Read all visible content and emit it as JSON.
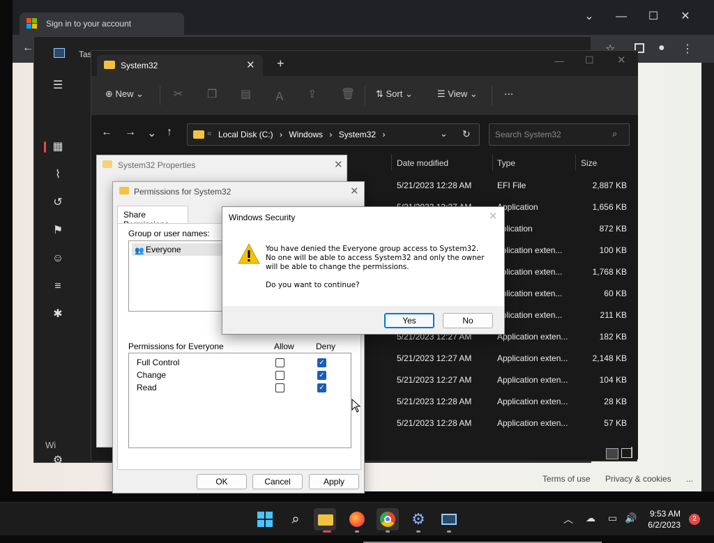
{
  "browser": {
    "tab_title": "Sign in to your account",
    "footer_terms": "Terms of use",
    "footer_privacy": "Privacy & cookies",
    "footer_more": "..."
  },
  "taskmgr": {
    "title": "Task Manager",
    "running_label": "Wi"
  },
  "explorer": {
    "tab_title": "System32",
    "new_label": "New",
    "sort_label": "Sort",
    "view_label": "View",
    "more_label": "...",
    "breadcrumb": [
      "Local Disk (C:)",
      "Windows",
      "System32"
    ],
    "search_placeholder": "Search System32",
    "columns": {
      "date": "Date modified",
      "type": "Type",
      "size": "Size"
    },
    "rows": [
      {
        "date": "5/21/2023 12:28 AM",
        "type": "EFI File",
        "size": "2,887 KB"
      },
      {
        "date": "5/21/2023 12:27 AM",
        "type": "Application",
        "size": "1,656 KB"
      },
      {
        "date": "",
        "type": "pplication",
        "size": "872 KB"
      },
      {
        "date": "",
        "type": "pplication exten...",
        "size": "100 KB"
      },
      {
        "date": "",
        "type": "pplication exten...",
        "size": "1,768 KB"
      },
      {
        "date": "",
        "type": "pplication exten...",
        "size": "60 KB"
      },
      {
        "date": "",
        "type": "pplication exten...",
        "size": "211 KB"
      },
      {
        "date": "5/21/2023 12:27 AM",
        "type": "Application exten...",
        "size": "182 KB"
      },
      {
        "date": "5/21/2023 12:27 AM",
        "type": "Application exten...",
        "size": "2,148 KB"
      },
      {
        "date": "5/21/2023 12:27 AM",
        "type": "Application exten...",
        "size": "104 KB"
      },
      {
        "date": "5/21/2023 12:28 AM",
        "type": "Application exten...",
        "size": "28 KB"
      },
      {
        "date": "5/21/2023 12:28 AM",
        "type": "Application exten...",
        "size": "57 KB"
      }
    ]
  },
  "props": {
    "title": "System32 Properties"
  },
  "perms": {
    "title": "Permissions for System32",
    "tab_label": "Share Permissions",
    "group_label": "Group or user names:",
    "group_item": "Everyone",
    "perm_for_label": "Permissions for Everyone",
    "allow_label": "Allow",
    "deny_label": "Deny",
    "permissions": [
      {
        "name": "Full Control",
        "allow": false,
        "deny": true
      },
      {
        "name": "Change",
        "allow": false,
        "deny": true
      },
      {
        "name": "Read",
        "allow": false,
        "deny": true
      }
    ],
    "ok_label": "OK",
    "cancel_label": "Cancel",
    "apply_label": "Apply"
  },
  "security": {
    "title": "Windows Security",
    "message": "You have denied the Everyone group access to System32. No one will be able to access System32 and only the owner will be able to change the permissions.",
    "question": "Do you want to continue?",
    "yes_label": "Yes",
    "no_label": "No"
  },
  "taskbar": {
    "time": "9:53 AM",
    "date": "6/2/2023",
    "notification_count": "2"
  },
  "colors": {
    "accent": "#0078d4",
    "deny_check": "#1a5fb4",
    "badge": "#e5484d"
  }
}
